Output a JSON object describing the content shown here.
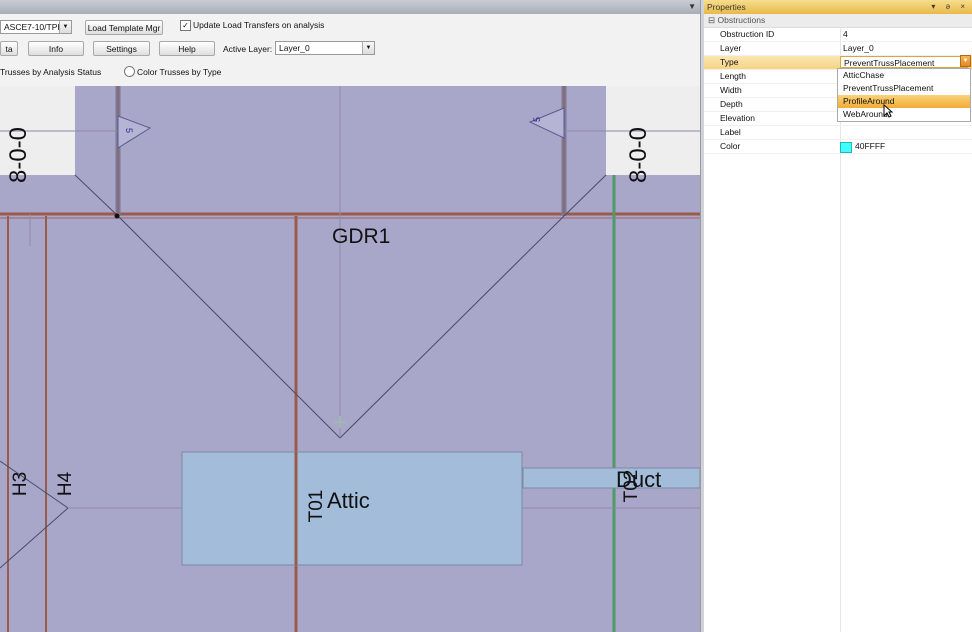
{
  "toolbar": {
    "code_combo": "ASCE7-10/TPI-2(",
    "load_template_btn": "Load Template Mgr",
    "update_transfers_check": "✓",
    "update_transfers_label": "Update Load Transfers on analysis",
    "data_btn": "ta",
    "info_btn": "Info",
    "settings_btn": "Settings",
    "help_btn": "Help",
    "active_layer_label": "Active Layer:",
    "active_layer_value": "Layer_0",
    "color_by_status_label": "Trusses by Analysis Status",
    "color_by_type_label": "Color Trusses by Type"
  },
  "canvas": {
    "labels": {
      "dim_left": "8-0-0",
      "dim_right": "8-0-0",
      "gdr": "GDR1",
      "h3": "H3",
      "h4": "H4",
      "t01": "T01",
      "t02": "T02",
      "attic": "Attic",
      "duct": "Duct",
      "marker_left": "5",
      "marker_right": "5"
    }
  },
  "properties": {
    "title": "Properties",
    "header_icons": "▾ ə ×",
    "category": "Obstructions",
    "rows": [
      {
        "name": "Obstruction ID",
        "value": "4"
      },
      {
        "name": "Layer",
        "value": "Layer_0"
      },
      {
        "name": "Type",
        "value": "PreventTrussPlacement"
      },
      {
        "name": "Length",
        "value": ""
      },
      {
        "name": "Width",
        "value": ""
      },
      {
        "name": "Depth",
        "value": ""
      },
      {
        "name": "Elevation",
        "value": ""
      },
      {
        "name": "Label",
        "value": ""
      },
      {
        "name": "Color",
        "value": "40FFFF"
      }
    ],
    "type_options": [
      "AtticChase",
      "PreventTrussPlacement",
      "ProfileAround",
      "WebAround"
    ],
    "type_highlighted": "ProfileAround"
  },
  "colors": {
    "canvas_bg": "#a9a7c9",
    "obstruction_fill": "#a3bcd9",
    "truss_line": "#9b5b4b",
    "green_line": "#4f9a68",
    "selection_header": "#e9b949",
    "color_swatch": "#40FFFF"
  }
}
